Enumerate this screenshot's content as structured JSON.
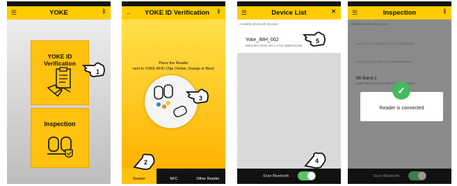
{
  "screens": {
    "home": {
      "title": "YOKE",
      "verification_card": "YOKE ID Verification",
      "inspection_card": "Inspection",
      "step": "1"
    },
    "verification": {
      "title": "YOKE ID Verification",
      "instruction_line1": "Place the Reader",
      "instruction_line2": "next to YOKE RFID Chip (Yellow, Orange or Blue)",
      "step_tag": "3",
      "step_tab": "2",
      "tabs": [
        "Reader",
        "NFC",
        "Other Reader"
      ]
    },
    "device_list": {
      "title": "Device List",
      "section_label": "Available Bluetooth Devices",
      "device_name": "Yoke_IMH_002",
      "device_id": "58D4A5C3-8618-41CA-C715-38B8F6CD59",
      "step_device": "5",
      "step_toggle": "4",
      "scan_label": "Scan Bluetooth"
    },
    "inspection": {
      "title": "Inspection",
      "section_label": "Available Bluetooth Devices",
      "device1": "28FC16C2-F924-4BCE-B109-E0EC9EC5E974",
      "device2": "A164D071-94F8-4527-80CF-3E6BEDB2B60",
      "band_name": "MI Band 2",
      "band_id": "5420F48B-CDEA-4071-BDA3-D4F3C6D4AD03",
      "message": "Reader is connected",
      "scan_label": "Scan Bluetooth"
    }
  },
  "colors": {
    "yellow": "#ffcc00",
    "green": "#44b95d",
    "black": "#111111"
  },
  "icons": [
    "menu-icon",
    "back-arrow-icon",
    "bluetooth-icon",
    "pointing-hand-icon",
    "check-icon",
    "clipboard-handshake-icon",
    "yoke-hooks-icon"
  ]
}
